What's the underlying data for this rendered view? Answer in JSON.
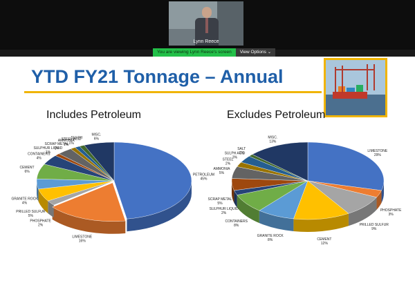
{
  "participant": {
    "name": "Lynn Reece"
  },
  "viewbar": {
    "notice": "You are viewing Lynn Reece's screen",
    "options": "View Options"
  },
  "slide": {
    "title": "YTD FY21 Tonnage – Annual",
    "left_subtitle": "Includes Petroleum",
    "right_subtitle": "Excludes Petroleum"
  },
  "chart_data": [
    {
      "type": "pie",
      "slices": [
        {
          "label": "PETROLEUM",
          "pct": "45%",
          "value": 45,
          "color": "#4472c4"
        },
        {
          "label": "LIMESTONE",
          "pct": "16%",
          "value": 16,
          "color": "#ed7d31"
        },
        {
          "label": "PHOSPHATE",
          "pct": "2%",
          "value": 2,
          "color": "#a5a5a5"
        },
        {
          "label": "PRILLED SULFUR",
          "pct": "5%",
          "value": 5,
          "color": "#ffc000"
        },
        {
          "label": "GRANITE ROCK",
          "pct": "4%",
          "value": 4,
          "color": "#5b9bd5"
        },
        {
          "label": "CEMENT",
          "pct": "6%",
          "value": 6,
          "color": "#70ad47"
        },
        {
          "label": "CONTAINERS",
          "pct": "4%",
          "value": 4,
          "color": "#264478"
        },
        {
          "label": "SULPHUR LIQUID",
          "pct": "1%",
          "value": 1,
          "color": "#9e480e"
        },
        {
          "label": "SCRAP METAL",
          "pct": "3%",
          "value": 3,
          "color": "#636363"
        },
        {
          "label": "AMMONIA",
          "pct": "1%",
          "value": 1,
          "color": "#997300"
        },
        {
          "label": "STEEL ACID",
          "pct": "1%",
          "value": 1,
          "color": "#255e91"
        },
        {
          "label": "SULPH",
          "pct": "",
          "value": 1,
          "color": "#43682b"
        },
        {
          "label": "MISC.",
          "pct": "6%",
          "value": 6,
          "color": "#203864"
        }
      ]
    },
    {
      "type": "pie",
      "slices": [
        {
          "label": "LIMESTONE",
          "pct": "29%",
          "value": 29,
          "color": "#4472c4"
        },
        {
          "label": "PHOSPHATE",
          "pct": "3%",
          "value": 3,
          "color": "#ed7d31"
        },
        {
          "label": "PRILLED SULFUR",
          "pct": "9%",
          "value": 9,
          "color": "#a5a5a5"
        },
        {
          "label": "CEMENT",
          "pct": "12%",
          "value": 12,
          "color": "#ffc000"
        },
        {
          "label": "GRANITE ROCK",
          "pct": "8%",
          "value": 8,
          "color": "#5b9bd5"
        },
        {
          "label": "CONTAINERS",
          "pct": "8%",
          "value": 8,
          "color": "#70ad47"
        },
        {
          "label": "SULPHUR LIQUID",
          "pct": "2%",
          "value": 2,
          "color": "#264478"
        },
        {
          "label": "SCRAP METAL",
          "pct": "5%",
          "value": 5,
          "color": "#9e480e"
        },
        {
          "label": "AMMONIA",
          "pct": "5%",
          "value": 5,
          "color": "#636363"
        },
        {
          "label": "STEEL",
          "pct": "2%",
          "value": 2,
          "color": "#997300"
        },
        {
          "label": "SULPH ACID",
          "pct": "3%",
          "value": 3,
          "color": "#255e91"
        },
        {
          "label": "SALT",
          "pct": "1%",
          "value": 1,
          "color": "#43682b"
        },
        {
          "label": "MISC.",
          "pct": "13%",
          "value": 13,
          "color": "#203864"
        }
      ]
    }
  ]
}
